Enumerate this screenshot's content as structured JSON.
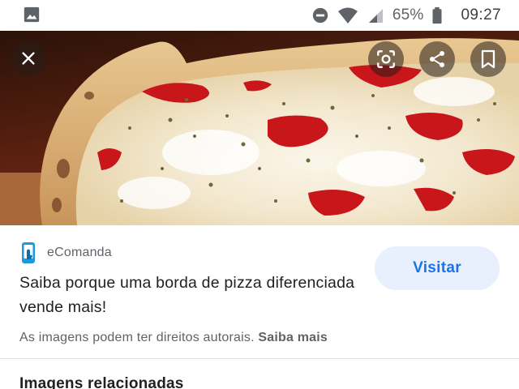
{
  "status_bar": {
    "left_icon": "image-notification-icon",
    "icons": [
      "do-not-disturb-icon",
      "wifi-icon",
      "cell-signal-icon",
      "battery-icon"
    ],
    "battery_percent": "65%",
    "time": "09:27"
  },
  "viewer": {
    "close_icon": "close-icon",
    "action_icons": [
      "lens-icon",
      "share-icon",
      "bookmark-icon"
    ]
  },
  "result": {
    "source_icon": "ecomanda-logo-icon",
    "source_name": "eComanda",
    "visit_label": "Visitar",
    "title": "Saiba porque uma borda de pizza diferenciada vende mais!",
    "copyright_notice": "As imagens podem ter direitos autorais.",
    "learn_more": "Saiba mais"
  },
  "related_heading": "Imagens relacionadas",
  "colors": {
    "accent": "#1a73e8",
    "visit_bg": "#e8f0fe",
    "secondary_text": "#5f6368"
  }
}
